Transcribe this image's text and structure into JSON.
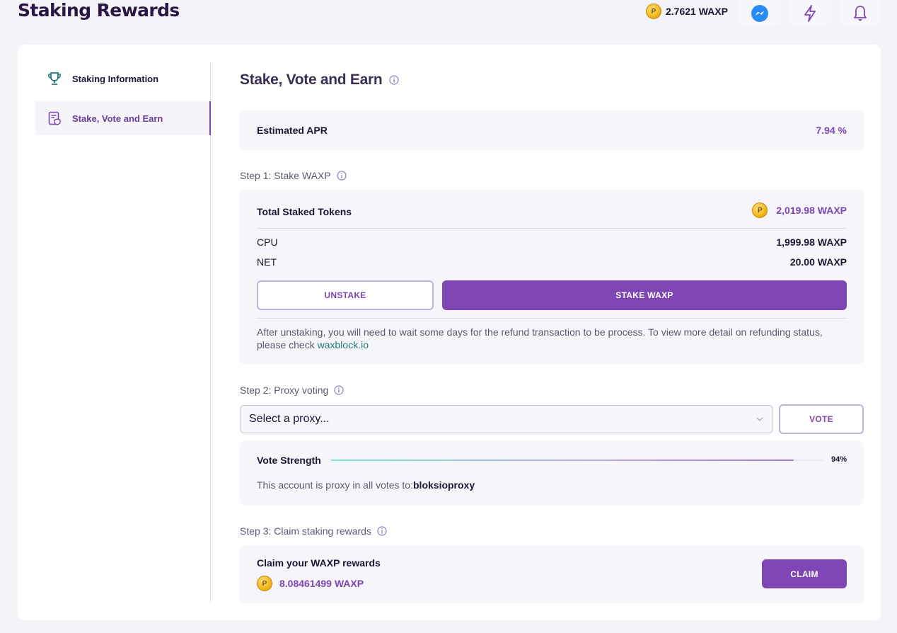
{
  "header": {
    "title": "Staking Rewards",
    "balance": "2.7621 WAXP",
    "icons": [
      "coin-icon",
      "messenger-icon",
      "lightning-icon",
      "bell-icon"
    ]
  },
  "sidebar": {
    "items": [
      {
        "label": "Staking Information",
        "icon": "trophy-icon",
        "active": false
      },
      {
        "label": "Stake, Vote and Earn",
        "icon": "document-shield-icon",
        "active": true
      }
    ]
  },
  "main": {
    "title": "Stake, Vote and Earn",
    "apr": {
      "label": "Estimated APR",
      "value": "7.94 %"
    },
    "step1": {
      "label": "Step 1: Stake WAXP",
      "total_label": "Total Staked Tokens",
      "total_value": "2,019.98 WAXP",
      "cpu_label": "CPU",
      "cpu_value": "1,999.98 WAXP",
      "net_label": "NET",
      "net_value": "20.00 WAXP",
      "unstake_button": "UNSTAKE",
      "stake_button": "STAKE WAXP",
      "note": "After unstaking, you will need to wait some days for the refund transaction to be process. To view more detail on refunding status, please check",
      "note_link": "waxblock.io"
    },
    "step2": {
      "label": "Step 2: Proxy voting",
      "select_placeholder": "Select a proxy...",
      "vote_button": "VOTE",
      "strength_label": "Vote Strength",
      "strength_value": "94%",
      "strength_fraction": 0.94,
      "proxy_text": "This account is proxy in all votes to:",
      "proxy_name": "bloksioproxy"
    },
    "step3": {
      "label": "Step 3: Claim staking rewards",
      "claim_title": "Claim your WAXP rewards",
      "claim_amount": "8.08461499 WAXP",
      "claim_button": "CLAIM"
    }
  },
  "colors": {
    "accent": "#7e46b5",
    "link": "#1f7a7a",
    "panel": "#f6f5fa"
  }
}
